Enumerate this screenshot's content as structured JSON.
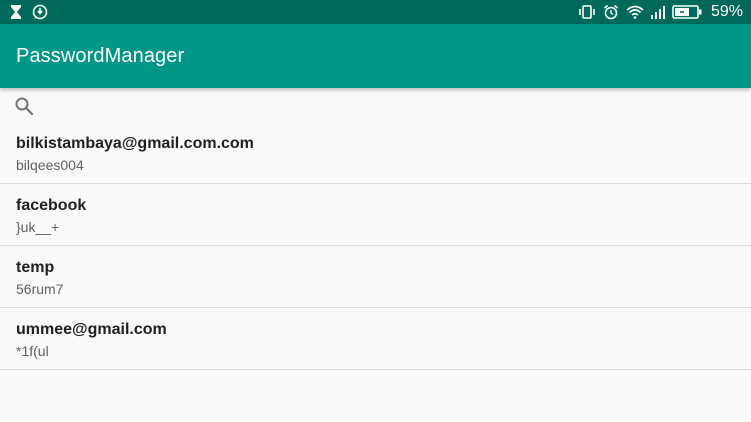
{
  "status_bar": {
    "battery_percent": "59%",
    "left_icons": [
      "hourglass-icon",
      "whatsapp-icon"
    ],
    "right_icons": [
      "vibrate-icon",
      "alarm-icon",
      "wifi-icon",
      "signal-icon",
      "battery-charging-icon"
    ]
  },
  "app_bar": {
    "title": "PasswordManager",
    "color": "#009688",
    "status_color": "#00695c"
  },
  "search": {
    "icon": "search-icon"
  },
  "entries": [
    {
      "account": "bilkistambaya@gmail.com.com",
      "password": "bilqees004"
    },
    {
      "account": "facebook",
      "password": "}uk__+"
    },
    {
      "account": "temp",
      "password": "56rum7"
    },
    {
      "account": "ummee@gmail.com",
      "password": "*1f(ul"
    }
  ]
}
